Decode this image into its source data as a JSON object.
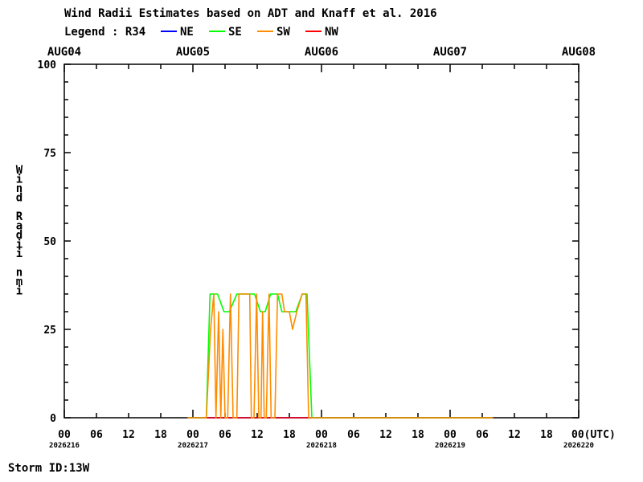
{
  "chart_data": {
    "type": "line",
    "title": "Wind Radii Estimates based on ADT and Knaff et al. 2016",
    "legend": {
      "prefix": "Legend : R34",
      "entries": [
        {
          "name": "NE",
          "color": "#0000ff"
        },
        {
          "name": "SE",
          "color": "#00ff00"
        },
        {
          "name": "SW",
          "color": "#ff8c00"
        },
        {
          "name": "NW",
          "color": "#ff0000"
        }
      ]
    },
    "ylabel": "Wind Radii nmi",
    "ylim": [
      0,
      100
    ],
    "y_ticks": [
      "0",
      "25",
      "50",
      "75",
      "100"
    ],
    "xlim": [
      0,
      96
    ],
    "x_unit": "hours since 2026216 00 UTC",
    "x_tick_labels": [
      "00",
      "06",
      "12",
      "18",
      "00",
      "06",
      "12",
      "18",
      "00",
      "06",
      "12",
      "18",
      "00",
      "06",
      "12",
      "18",
      "00(UTC)"
    ],
    "x_date_labels": [
      "2026216",
      "2026217",
      "2026218",
      "2026219",
      "2026220"
    ],
    "top_date_labels": [
      "AUG04",
      "AUG05",
      "AUG06",
      "AUG07",
      "AUG08"
    ],
    "grid": false,
    "series": [
      {
        "name": "NE",
        "color": "#0000ff",
        "points": [
          [
            23,
            0
          ],
          [
            80,
            0
          ]
        ]
      },
      {
        "name": "NW",
        "color": "#ff0000",
        "points": [
          [
            23,
            0
          ],
          [
            80,
            0
          ]
        ]
      },
      {
        "name": "SE",
        "color": "#00ff00",
        "points": [
          [
            23,
            0
          ],
          [
            26.5,
            0
          ],
          [
            27.2,
            35
          ],
          [
            28.6,
            35
          ],
          [
            29.8,
            30
          ],
          [
            30.8,
            30
          ],
          [
            32.2,
            35
          ],
          [
            35.5,
            35
          ],
          [
            36.6,
            30
          ],
          [
            37.5,
            30
          ],
          [
            38.5,
            35
          ],
          [
            39.8,
            35
          ],
          [
            40.6,
            30
          ],
          [
            43.2,
            30
          ],
          [
            44.4,
            35
          ],
          [
            45.3,
            35
          ],
          [
            46.2,
            0
          ],
          [
            80,
            0
          ]
        ]
      },
      {
        "name": "SW",
        "color": "#ff8c00",
        "points": [
          [
            23,
            0
          ],
          [
            26.5,
            0
          ],
          [
            27.3,
            25
          ],
          [
            27.9,
            35
          ],
          [
            28.3,
            0
          ],
          [
            28.8,
            30
          ],
          [
            29.2,
            0
          ],
          [
            29.6,
            25
          ],
          [
            30.0,
            0
          ],
          [
            30.5,
            0
          ],
          [
            31.0,
            35
          ],
          [
            31.5,
            0
          ],
          [
            32.2,
            0
          ],
          [
            32.6,
            35
          ],
          [
            34.6,
            35
          ],
          [
            34.9,
            0
          ],
          [
            35.4,
            0
          ],
          [
            35.9,
            35
          ],
          [
            36.3,
            0
          ],
          [
            36.7,
            0
          ],
          [
            37.0,
            30
          ],
          [
            37.3,
            0
          ],
          [
            37.7,
            0
          ],
          [
            38.2,
            35
          ],
          [
            38.6,
            0
          ],
          [
            39.3,
            0
          ],
          [
            39.8,
            35
          ],
          [
            40.6,
            35
          ],
          [
            41.1,
            30
          ],
          [
            42.0,
            30
          ],
          [
            42.6,
            25
          ],
          [
            43.4,
            30
          ],
          [
            44.4,
            35
          ],
          [
            45.1,
            35
          ],
          [
            45.6,
            0
          ],
          [
            80,
            0
          ]
        ]
      }
    ]
  },
  "footer": {
    "storm_id": "Storm ID:13W"
  }
}
